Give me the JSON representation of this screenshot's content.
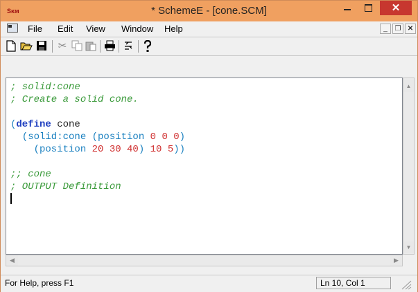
{
  "window": {
    "title": "* SchemeE - [cone.SCM]",
    "app_icon_text": "Sᴋᴍ",
    "close_glyph": "✕"
  },
  "menu": {
    "items": [
      "File",
      "Edit",
      "View",
      "Window",
      "Help"
    ]
  },
  "toolbar": {
    "icons": [
      "new-file-icon",
      "open-folder-icon",
      "save-icon",
      "cut-icon",
      "copy-icon",
      "paste-icon",
      "print-icon",
      "indent-icon",
      "help-icon"
    ]
  },
  "editor": {
    "lines": [
      [
        {
          "t": "; solid:cone",
          "c": "c-green"
        }
      ],
      [
        {
          "t": "; Create a solid cone.",
          "c": "c-green"
        }
      ],
      [
        {
          "t": "",
          "c": "c-id"
        }
      ],
      [
        {
          "t": "(",
          "c": "c-fn"
        },
        {
          "t": "define",
          "c": "c-kw"
        },
        {
          "t": " cone",
          "c": "c-id"
        }
      ],
      [
        {
          "t": "  (solid:cone (position ",
          "c": "c-fn"
        },
        {
          "t": "0 0 0",
          "c": "c-num"
        },
        {
          "t": ")",
          "c": "c-fn"
        }
      ],
      [
        {
          "t": "    (position ",
          "c": "c-fn"
        },
        {
          "t": "20 30 40",
          "c": "c-num"
        },
        {
          "t": ") ",
          "c": "c-fn"
        },
        {
          "t": "10 5",
          "c": "c-num"
        },
        {
          "t": "))",
          "c": "c-fn"
        }
      ],
      [
        {
          "t": "",
          "c": "c-id"
        }
      ],
      [
        {
          "t": ";; cone",
          "c": "c-green"
        }
      ],
      [
        {
          "t": "; OUTPUT Definition",
          "c": "c-green"
        }
      ]
    ]
  },
  "status": {
    "help": "For Help, press F1",
    "position": "Ln 10, Col 1"
  },
  "colors": {
    "titlebar": "#f0a060",
    "close_button": "#c7372f",
    "comment": "#3a9a3a",
    "keyword": "#2040c0",
    "function": "#1a80c0",
    "number": "#d03030"
  }
}
